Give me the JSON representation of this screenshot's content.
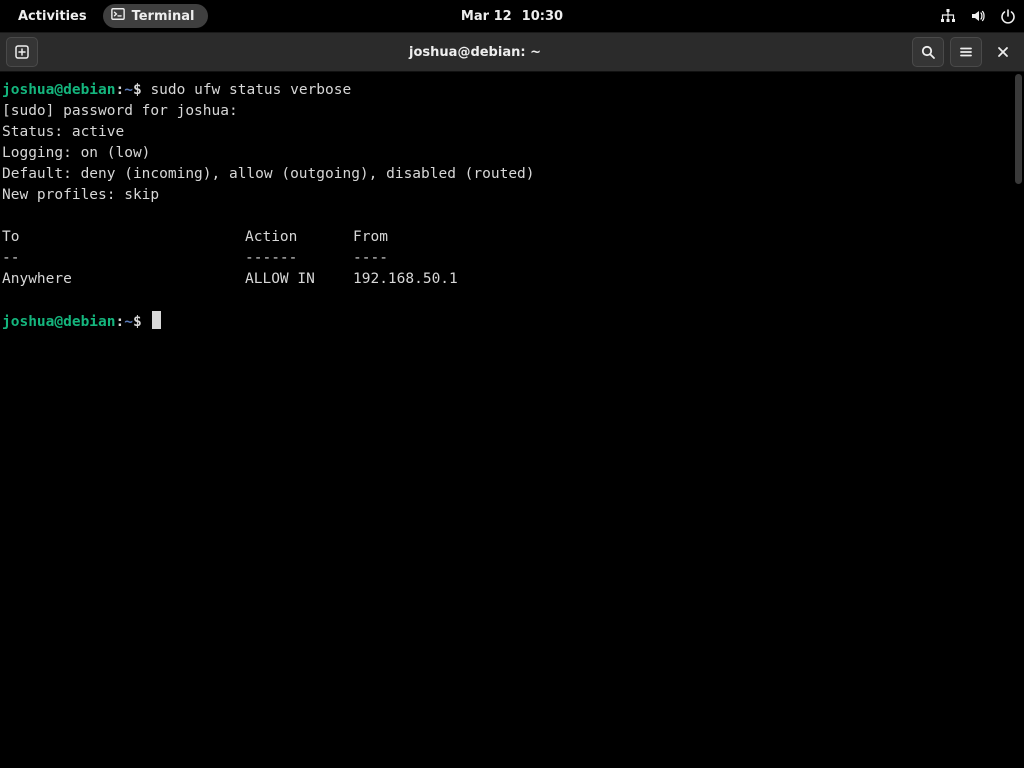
{
  "top_panel": {
    "activities": "Activities",
    "app_label": "Terminal",
    "date": "Mar 12",
    "time": "10:30"
  },
  "titlebar": {
    "title": "joshua@debian: ~"
  },
  "prompt": {
    "user_host": "joshua@debian",
    "colon": ":",
    "path": "~",
    "dollar": "$"
  },
  "session": {
    "command": "sudo ufw status verbose",
    "sudo_prompt": "[sudo] password for joshua:",
    "status": "Status: active",
    "logging": "Logging: on (low)",
    "default": "Default: deny (incoming), allow (outgoing), disabled (routed)",
    "new_profiles": "New profiles: skip",
    "header": {
      "to": "To",
      "action": "Action",
      "from": "From"
    },
    "header_sep": {
      "to": "--",
      "action": "------",
      "from": "----"
    },
    "rules": [
      {
        "to": "Anywhere",
        "action": "ALLOW IN",
        "from": "192.168.50.1"
      }
    ]
  }
}
